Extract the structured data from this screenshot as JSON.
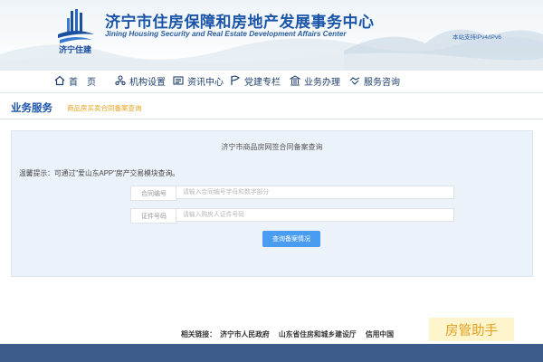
{
  "header": {
    "title": "济宁市住房保障和房地产发展事务中心",
    "subtitle": "Jining Housing Security and Real Estate Development Affairs Center",
    "logo_text": "济宁住建",
    "ipv6_note": "本站支持IPv4/IPv6"
  },
  "nav": {
    "items": [
      {
        "label": "首　页",
        "icon": "home-icon"
      },
      {
        "label": "机构设置",
        "icon": "org-icon"
      },
      {
        "label": "资讯中心",
        "icon": "news-icon"
      },
      {
        "label": "党建专栏",
        "icon": "flag-icon"
      },
      {
        "label": "业务办理",
        "icon": "building-icon"
      },
      {
        "label": "服务咨询",
        "icon": "handshake-icon"
      }
    ]
  },
  "section": {
    "title": "业务服务",
    "breadcrumb": "商品房买卖合同备案查询"
  },
  "panel": {
    "title": "济宁市商品房网签合同备案查询",
    "tip": "温馨提示：可通过\"爱山东APP\"房产交易模块查询。",
    "fields": [
      {
        "label": "合同编号",
        "placeholder": "请输入合同编号字母和数字部分"
      },
      {
        "label": "证件号码",
        "placeholder": "请输入购房人证件号码"
      }
    ],
    "button_label": "查询备案情况"
  },
  "footer": {
    "links_label": "相关链接：",
    "links": [
      "济宁市人民政府",
      "山东省住房和城乡建设厅",
      "信用中国"
    ]
  },
  "watermark": "房管助手",
  "colors": {
    "brand_blue": "#1a55a8",
    "accent_orange": "#e8a21a",
    "button_blue": "#4a9cf0",
    "footer_bar": "#3d5c8c"
  }
}
